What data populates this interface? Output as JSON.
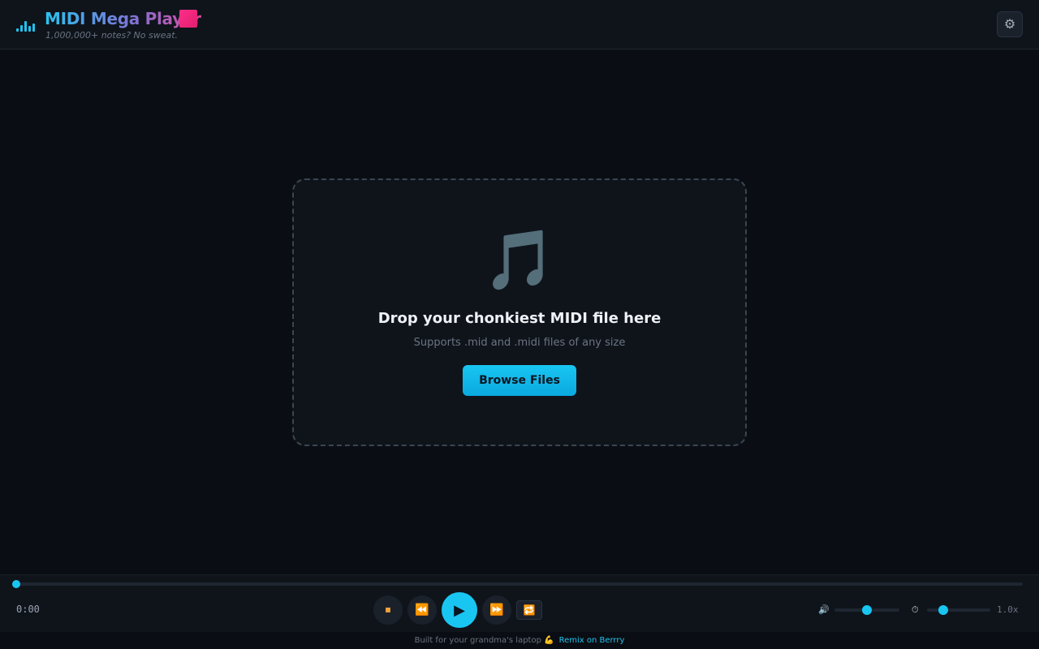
{
  "header": {
    "title": "MIDI Mega Player",
    "subtitle": "1,000,000+ notes? No sweat.",
    "logo_icon": "equalizer-bars-icon",
    "settings_icon": "⚙"
  },
  "dropzone": {
    "icon": "🎵",
    "title": "Drop your chonkiest MIDI file here",
    "subtitle": "Supports .mid and .midi files of any size",
    "browse_label": "Browse Files"
  },
  "player": {
    "time": "0:00",
    "progress": 0,
    "stop_icon": "⏹",
    "rewind_icon": "⏪",
    "play_icon": "▶",
    "forward_icon": "⏩",
    "loop_icon": "🔁",
    "volume_icon": "🔊",
    "volume": 0.5,
    "speed_icon": "⏱",
    "speed_level": 0.25,
    "speed_label": "1.0x"
  },
  "footer": {
    "text": "Built for your grandma's laptop 💪",
    "link": "Remix on Berrry"
  },
  "colors": {
    "accent": "#19c6f2",
    "background": "#0a0d13",
    "panel": "#0f141b",
    "control_icon": "#f2a33a"
  }
}
